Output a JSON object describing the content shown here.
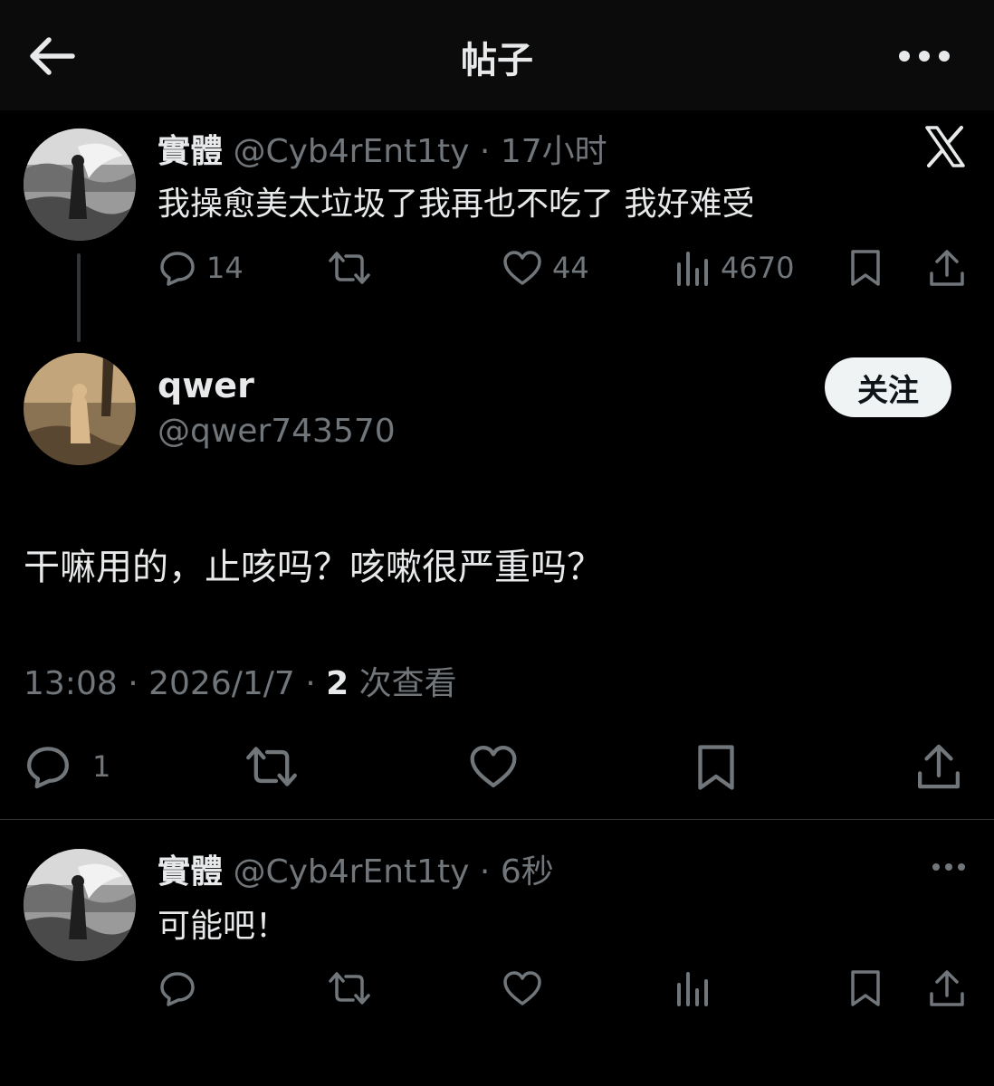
{
  "header": {
    "title": "帖子"
  },
  "parent_post": {
    "display_name": "實體",
    "handle": "@Cyb4rEnt1ty",
    "separator": "·",
    "time": "17小时",
    "text": "我操愈美太垃圾了我再也不吃了 我好难受",
    "replies": "14",
    "likes": "44",
    "views": "4670"
  },
  "main_post": {
    "display_name": "qwer",
    "handle": "@qwer743570",
    "follow_label": "关注",
    "text": "干嘛用的，止咳吗？咳嗽很严重吗？",
    "time": "13:08",
    "sep1": "·",
    "date": "2026/1/7",
    "sep2": "·",
    "view_count": "2",
    "view_label": " 次查看",
    "replies": "1"
  },
  "reply_post": {
    "display_name": "實體",
    "handle": "@Cyb4rEnt1ty",
    "separator": "·",
    "time": "6秒",
    "text": "可能吧！"
  },
  "icons": [
    "back-arrow-icon",
    "more-icon",
    "x-logo-icon",
    "reply-icon",
    "retweet-icon",
    "like-icon",
    "views-icon",
    "bookmark-icon",
    "share-icon"
  ],
  "colors": {
    "background": "#000000",
    "header": "#0b0b0b",
    "text": "#e7e9ea",
    "muted": "#71767b",
    "follow_bg": "#eff3f4"
  }
}
